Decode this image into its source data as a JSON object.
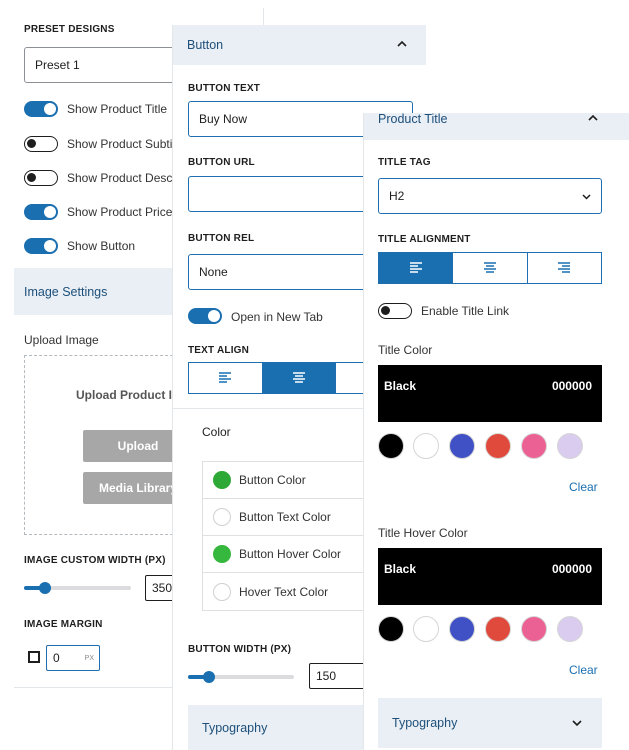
{
  "panel_preset": {
    "preset_label": "PRESET DESIGNS",
    "preset_value": "Preset 1",
    "toggles": [
      {
        "label": "Show Product Title",
        "on": true
      },
      {
        "label": "Show Product Subtitle",
        "on": false
      },
      {
        "label": "Show Product Description",
        "on": false
      },
      {
        "label": "Show Product Price",
        "on": true
      },
      {
        "label": "Show Button",
        "on": true
      }
    ],
    "image_settings_title": "Image Settings",
    "upload_image_label": "Upload Image",
    "upload_heading": "Upload Product Image",
    "upload_button": "Upload",
    "media_library_button": "Media Library",
    "image_width_label": "IMAGE CUSTOM WIDTH (PX)",
    "image_width_value": "350",
    "image_width_fraction": 0.2,
    "image_margin_label": "IMAGE MARGIN",
    "image_margin_value": "0",
    "image_margin_unit": "PX"
  },
  "panel_button": {
    "title": "Button",
    "button_text_label": "BUTTON TEXT",
    "button_text_value": "Buy Now",
    "button_url_label": "BUTTON URL",
    "button_url_value": "",
    "button_rel_label": "BUTTON REL",
    "button_rel_value": "None",
    "new_tab_label": "Open in New Tab",
    "new_tab_on": true,
    "text_align_label": "TEXT ALIGN",
    "text_align_active": "center",
    "color_title": "Color",
    "colors": [
      {
        "label": "Button Color",
        "color": "#2ea836"
      },
      {
        "label": "Button Text Color",
        "color": "#ffffff"
      },
      {
        "label": "Button Hover Color",
        "color": "#36b83f"
      },
      {
        "label": "Hover Text Color",
        "color": "#ffffff"
      }
    ],
    "width_label": "BUTTON WIDTH (PX)",
    "width_value": "150",
    "width_fraction": 0.2,
    "typography_title": "Typography"
  },
  "panel_title": {
    "title": "Product Title",
    "title_tag_label": "TITLE TAG",
    "title_tag_value": "H2",
    "alignment_label": "TITLE ALIGNMENT",
    "alignment_active": "left",
    "enable_link_label": "Enable Title Link",
    "enable_link_on": false,
    "title_color_label": "Title Color",
    "title_color_name": "Black",
    "title_color_hex": "000000",
    "hover_color_label": "Title Hover Color",
    "hover_color_name": "Black",
    "hover_color_hex": "000000",
    "palette": [
      "#000000",
      "#ffffff",
      "#3f51c4",
      "#e04a3c",
      "#ec6193",
      "#d9ccef"
    ],
    "clear_label": "Clear",
    "typography_title": "Typography"
  },
  "accent_color": "#1a6fb0"
}
